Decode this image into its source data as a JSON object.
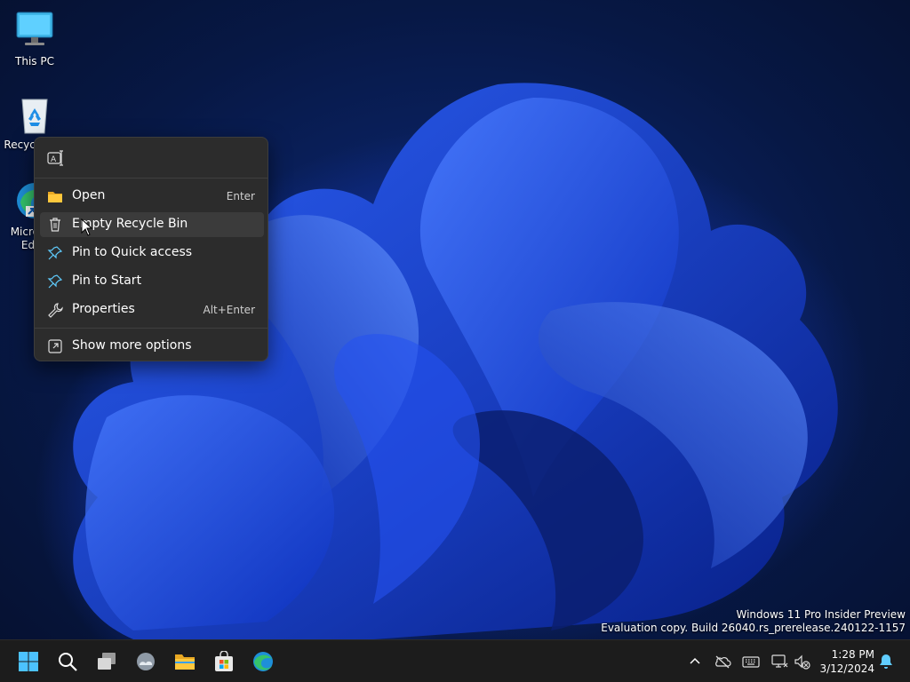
{
  "desktop": {
    "icons": [
      {
        "label": "This PC"
      },
      {
        "label": "Recycle Bin"
      },
      {
        "label": "Microsoft Edge"
      }
    ]
  },
  "context_menu": {
    "items": [
      {
        "label": "Open",
        "shortcut": "Enter",
        "icon": "folder-icon"
      },
      {
        "label": "Empty Recycle Bin",
        "shortcut": "",
        "icon": "trash-icon"
      },
      {
        "label": "Pin to Quick access",
        "shortcut": "",
        "icon": "pin-icon"
      },
      {
        "label": "Pin to Start",
        "shortcut": "",
        "icon": "pin-icon"
      },
      {
        "label": "Properties",
        "shortcut": "Alt+Enter",
        "icon": "wrench-icon"
      },
      {
        "label": "Show more options",
        "shortcut": "",
        "icon": "expand-icon"
      }
    ],
    "quick_actions": [
      "rename-icon"
    ]
  },
  "watermark": {
    "line1": "Windows 11 Pro Insider Preview",
    "line2": "Evaluation copy. Build 26040.rs_prerelease.240122-1157"
  },
  "taskbar": {
    "apps": [
      "start-icon",
      "search-icon",
      "task-view-icon",
      "widgets-icon",
      "file-explorer-icon",
      "store-icon",
      "edge-icon"
    ],
    "tray": [
      "chevron-up-icon",
      "onedrive-icon",
      "keyboard-icon",
      "network-icon",
      "volume-muted-icon"
    ],
    "time": "1:28 PM",
    "date": "3/12/2024"
  },
  "colors": {
    "accent": "#0067c0",
    "menu_bg": "#2c2c2c",
    "taskbar_bg": "#1c1c1c"
  }
}
